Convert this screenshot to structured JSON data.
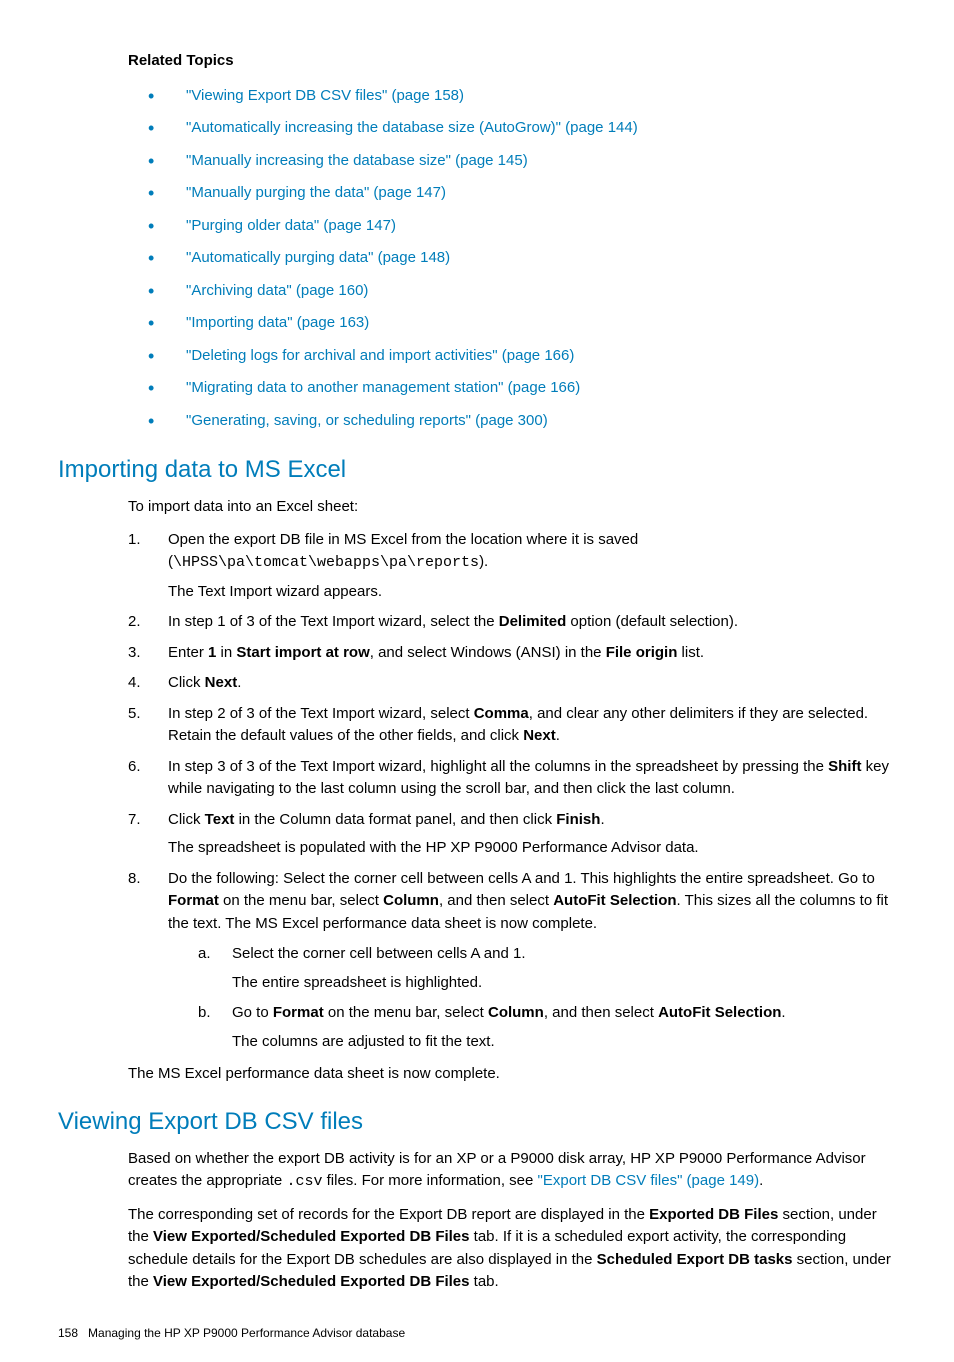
{
  "related": {
    "heading": "Related Topics",
    "items": [
      "\"Viewing Export DB CSV files\" (page 158)",
      "\"Automatically increasing the database size (AutoGrow)\" (page 144)",
      "\"Manually increasing the database size\" (page 145)",
      "\"Manually purging the data\" (page 147)",
      "\"Purging older data\" (page 147)",
      "\"Automatically purging data\" (page 148)",
      "\"Archiving data\" (page 160)",
      "\"Importing data\" (page 163)",
      "\"Deleting logs for archival and import activities\" (page 166)",
      "\"Migrating data to another management station\" (page 166)",
      "\"Generating, saving, or scheduling reports\" (page 300)"
    ]
  },
  "section1": {
    "title": "Importing data to MS Excel",
    "intro": "To import data into an Excel sheet:",
    "step1_a": "Open the export DB file in MS Excel from the location where it is saved (",
    "step1_path": "\\HPSS\\pa\\tomcat\\webapps\\pa\\reports",
    "step1_b": ").",
    "step1_c": "The Text Import wizard appears.",
    "step2_a": "In step 1 of 3 of the Text Import wizard, select the ",
    "step2_b": "Delimited",
    "step2_c": " option (default selection).",
    "step3_a": "Enter ",
    "step3_b": "1",
    "step3_c": " in ",
    "step3_d": "Start import at row",
    "step3_e": ", and select Windows (ANSI) in the ",
    "step3_f": "File origin",
    "step3_g": " list.",
    "step4_a": "Click ",
    "step4_b": "Next",
    "step4_c": ".",
    "step5_a": "In step 2 of 3 of the Text Import wizard, select ",
    "step5_b": "Comma",
    "step5_c": ", and clear any other delimiters if they are selected. Retain the default values of the other fields, and click ",
    "step5_d": "Next",
    "step5_e": ".",
    "step6_a": "In step 3 of 3 of the Text Import wizard, highlight all the columns in the spreadsheet by pressing the ",
    "step6_b": "Shift",
    "step6_c": " key while navigating to the last column using the scroll bar, and then click the last column.",
    "step7_a": "Click ",
    "step7_b": "Text",
    "step7_c": " in the Column data format panel, and then click ",
    "step7_d": "Finish",
    "step7_e": ".",
    "step7_f": "The spreadsheet is populated with the HP XP P9000 Performance Advisor data.",
    "step8_a": "Do the following: Select the corner cell between cells A and 1. This highlights the entire spreadsheet. Go to ",
    "step8_b": "Format",
    "step8_c": " on the menu bar, select ",
    "step8_d": "Column",
    "step8_e": ", and then select ",
    "step8_f": "AutoFit Selection",
    "step8_g": ". This sizes all the columns to fit the text. The MS Excel performance data sheet is now complete.",
    "sub_a1": "Select the corner cell between cells A and 1.",
    "sub_a2": "The entire spreadsheet is highlighted.",
    "sub_b1_a": "Go to ",
    "sub_b1_b": "Format",
    "sub_b1_c": " on the menu bar, select ",
    "sub_b1_d": "Column",
    "sub_b1_e": ", and then select ",
    "sub_b1_f": "AutoFit Selection",
    "sub_b1_g": ".",
    "sub_b2": "The columns are adjusted to fit the text.",
    "closing": "The MS Excel performance data sheet is now complete."
  },
  "section2": {
    "title": "Viewing Export DB CSV files",
    "p1_a": "Based on whether the export DB activity is for an XP or a P9000 disk array, HP XP P9000 Performance Advisor creates the appropriate ",
    "p1_b": ".csv",
    "p1_c": " files. For more information, see ",
    "p1_link": "\"Export DB CSV files\" (page 149)",
    "p1_d": ".",
    "p2_a": "The corresponding set of records for the Export DB report are displayed in the ",
    "p2_b": "Exported DB Files",
    "p2_c": " section, under the ",
    "p2_d": "View Exported/Scheduled Exported DB Files",
    "p2_e": " tab. If it is a scheduled export activity, the corresponding schedule details for the Export DB schedules are also displayed in the ",
    "p2_f": "Scheduled Export DB tasks",
    "p2_g": " section, under the ",
    "p2_h": "View Exported/Scheduled Exported DB Files",
    "p2_i": " tab."
  },
  "footer": {
    "page": "158",
    "title": "Managing the HP XP P9000 Performance Advisor database"
  }
}
